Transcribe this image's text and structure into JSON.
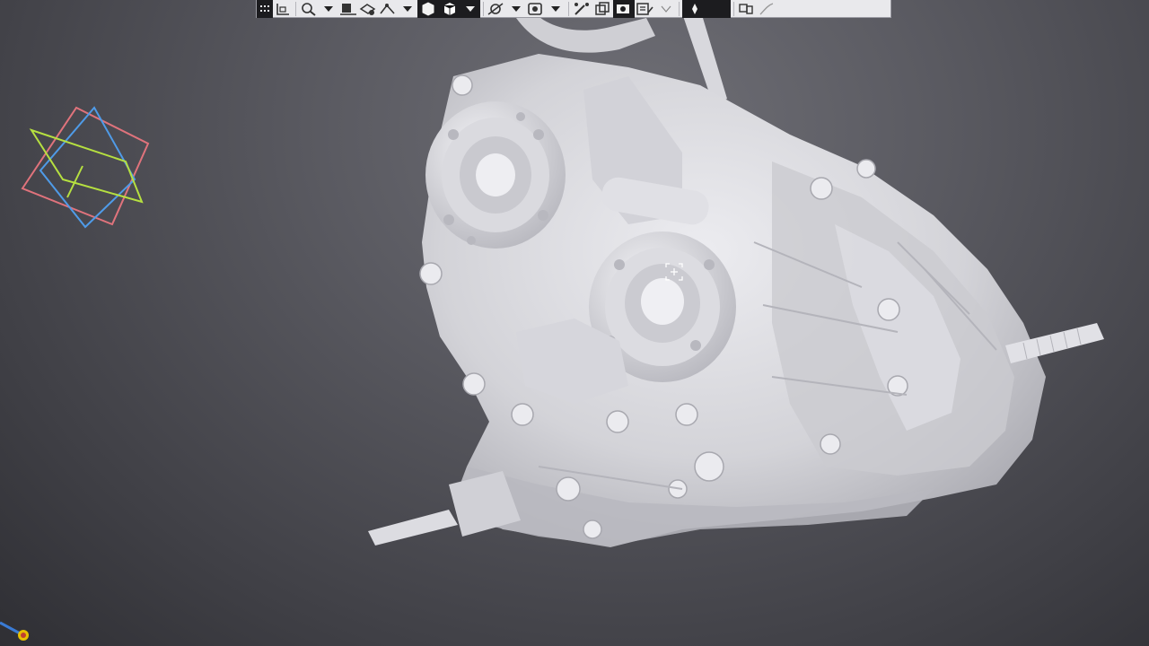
{
  "window": {
    "title": ""
  },
  "toolbar": {
    "buttons": [
      {
        "icon": "grip-icon"
      },
      {
        "icon": "sketch-plane-icon"
      },
      {
        "icon": "zoom-icon"
      },
      {
        "icon": "dropdown-chevron-icon"
      },
      {
        "icon": "view-orient-icon"
      },
      {
        "icon": "section-view-icon"
      },
      {
        "icon": "measure-icon"
      },
      {
        "icon": "dropdown-chevron-icon"
      },
      {
        "icon": "display-style-icon"
      },
      {
        "icon": "shaded-cube-icon"
      },
      {
        "icon": "dropdown-chevron-icon"
      },
      {
        "icon": "hide-show-icon"
      },
      {
        "icon": "dropdown-chevron-icon"
      },
      {
        "icon": "scene-icon"
      },
      {
        "icon": "dropdown-chevron-icon"
      },
      {
        "icon": "appearance-icon"
      },
      {
        "icon": "copy-icon"
      },
      {
        "icon": "render-icon"
      },
      {
        "icon": "settings-icon"
      },
      {
        "icon": "lights-icon"
      },
      {
        "icon": "camera-icon"
      },
      {
        "icon": "monitor-icon"
      }
    ]
  },
  "colors": {
    "background_top": "#6f6f76",
    "background_bottom": "#2f2f34",
    "model": "#d9d9de",
    "triad_red": "#e0737c",
    "triad_blue": "#4f9be8",
    "triad_green": "#b6e040",
    "toolbar_bg": "#e9e9ec"
  },
  "viewport": {
    "model_name": ""
  }
}
